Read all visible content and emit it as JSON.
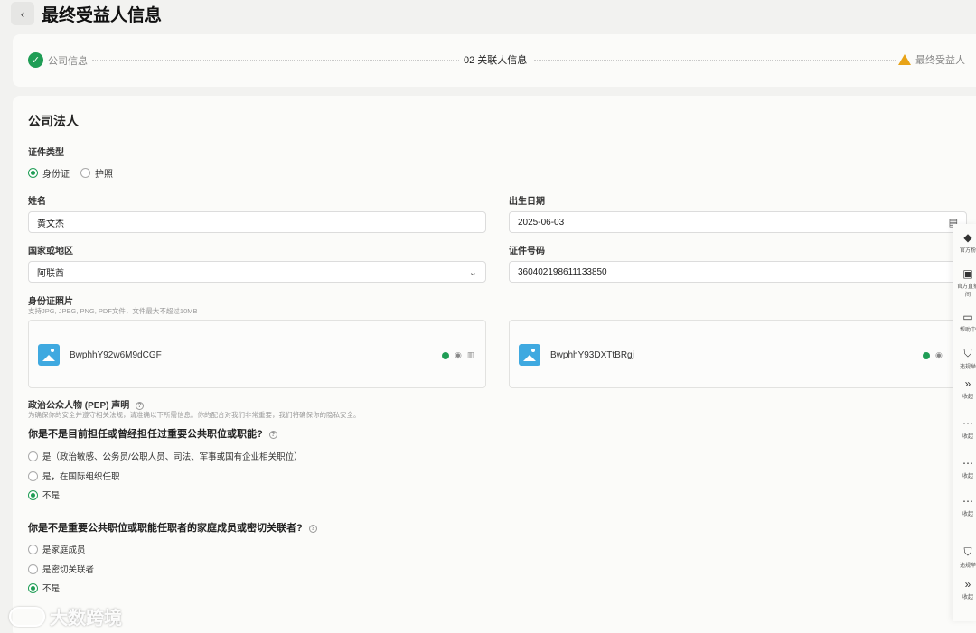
{
  "header": {
    "title": "最终受益人信息",
    "back_icon": "chevron-left-icon"
  },
  "steps": [
    {
      "label": "公司信息",
      "status": "done"
    },
    {
      "label": "02  关联人信息",
      "status": "current"
    },
    {
      "label": "最终受益人",
      "status": "warning"
    }
  ],
  "form": {
    "section_title": "公司法人",
    "id_type": {
      "label": "证件类型",
      "options": [
        "身份证",
        "护照"
      ],
      "selected": "身份证"
    },
    "name": {
      "label": "姓名",
      "value": "黄文杰"
    },
    "birth_date": {
      "label": "出生日期",
      "value": "2025-06-03"
    },
    "country": {
      "label": "国家或地区",
      "value": "阿联酋"
    },
    "id_number": {
      "label": "证件号码",
      "value": "360402198611133850"
    },
    "photos": {
      "label": "身份证照片",
      "hint": "支持JPG, JPEG, PNG, PDF文件，文件最大不超过10MB",
      "files": [
        "BwphhY92w6M9dCGF",
        "BwphhY93DXTtBRgj"
      ]
    },
    "pep": {
      "title": "政治公众人物 (PEP) 声明",
      "note": "为确保你的安全并遵守相关法规，请准确以下所需信息。你的配合对我们非常重要，我们将确保你的隐私安全。",
      "q1": {
        "text": "你是不是目前担任或曾经担任过重要公共职位或职能?",
        "options": [
          "是（政治敏感、公务员/公职人员、司法、军事或国有企业相关职位）",
          "是，在国际组织任职",
          "不是"
        ],
        "selected": "不是"
      },
      "q2": {
        "text": "你是不是重要公共职位或职能任职者的家庭成员或密切关联者?",
        "options": [
          "是家庭成员",
          "是密切关联者",
          "不是"
        ],
        "selected": "不是"
      }
    }
  },
  "right_rail": [
    {
      "icon": "logo-icon",
      "label": "官方粉"
    },
    {
      "icon": "live-icon",
      "label": "官方直播间"
    },
    {
      "icon": "chat-icon",
      "label": "帮助中"
    },
    {
      "icon": "shield-icon",
      "label": "违规举"
    },
    {
      "icon": "chevrons-right-icon",
      "label": "收起"
    },
    {
      "icon": "dots-icon",
      "label": "收起"
    },
    {
      "icon": "dots-icon",
      "label": "收起"
    },
    {
      "icon": "dots-icon",
      "label": "收起"
    },
    {
      "icon": "shield-icon",
      "label": "违规举"
    },
    {
      "icon": "chevrons-right-icon",
      "label": "收起"
    }
  ],
  "watermark": {
    "text": "大数跨境"
  },
  "colors": {
    "accent": "#1f9d55",
    "warning": "#e8a317",
    "thumb": "#3fa9e0"
  }
}
